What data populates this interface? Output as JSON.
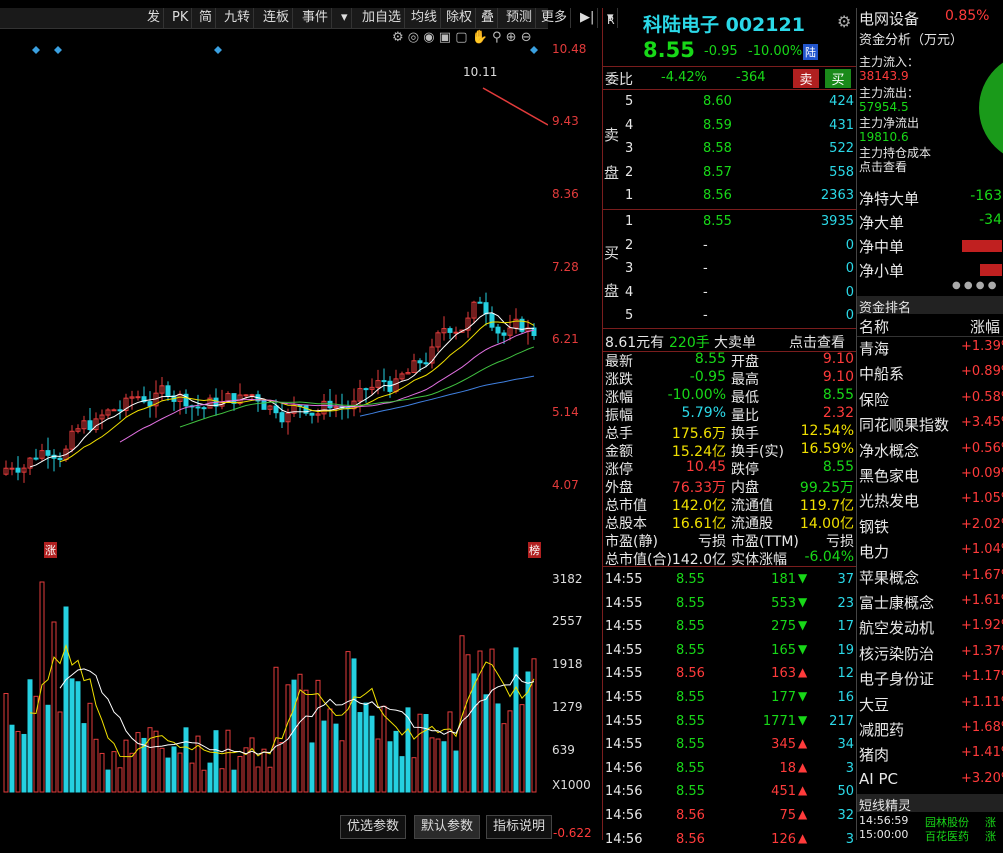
{
  "toolbar": {
    "items": [
      "发",
      "PK",
      "简",
      "九转",
      "连板",
      "事件",
      "▾",
      "加自选",
      "均线",
      "除权",
      "叠",
      "预测",
      "更多",
      "▶|",
      "▾"
    ]
  },
  "main_chart": {
    "price_labels": [
      "10.48",
      "9.43",
      "8.36",
      "7.28",
      "6.21",
      "5.14",
      "4.07"
    ],
    "high_marker": "10.11",
    "left_tag": "涨",
    "right_tag": "榜"
  },
  "vol_chart": {
    "labels": [
      "3182",
      "2557",
      "1918",
      "1279",
      "639",
      "X1000"
    ],
    "bottom_value": "-0.622",
    "tabs": [
      "优选参数",
      "默认参数",
      "指标说明"
    ]
  },
  "quote": {
    "badge": "R",
    "name": "科陆电子 002121",
    "price": "8.55",
    "change": "-0.95",
    "change_pct": "-10.00%",
    "land_tag": "陆",
    "weibi_label": "委比",
    "weibi_pct": "-4.42%",
    "weibi_val": "-364",
    "sell_btn": "卖",
    "buy_btn": "买",
    "sell_side_label": "卖盘",
    "buy_side_label": "买盘",
    "asks": [
      {
        "lvl": "5",
        "price": "8.60",
        "vol": "424"
      },
      {
        "lvl": "4",
        "price": "8.59",
        "vol": "431"
      },
      {
        "lvl": "3",
        "price": "8.58",
        "vol": "522"
      },
      {
        "lvl": "2",
        "price": "8.57",
        "vol": "558"
      },
      {
        "lvl": "1",
        "price": "8.56",
        "vol": "2363"
      }
    ],
    "bids": [
      {
        "lvl": "1",
        "price": "8.55",
        "vol": "3935"
      },
      {
        "lvl": "2",
        "price": "-",
        "vol": "0"
      },
      {
        "lvl": "3",
        "price": "-",
        "vol": "0"
      },
      {
        "lvl": "4",
        "price": "-",
        "vol": "0"
      },
      {
        "lvl": "5",
        "price": "-",
        "vol": "0"
      }
    ],
    "bigorder": {
      "amount": "8.61元有",
      "hands": "220手",
      "label": "大卖单",
      "link": "点击查看"
    },
    "stats": [
      [
        "最新",
        "8.55",
        "开盘",
        "9.10"
      ],
      [
        "涨跌",
        "-0.95",
        "最高",
        "9.10"
      ],
      [
        "涨幅",
        "-10.00%",
        "最低",
        "8.55"
      ],
      [
        "振幅",
        "5.79%",
        "量比",
        "2.32"
      ],
      [
        "总手",
        "175.6万",
        "换手",
        "12.54%"
      ],
      [
        "金额",
        "15.24亿",
        "换手(实)",
        "16.59%"
      ],
      [
        "涨停",
        "10.45",
        "跌停",
        "8.55"
      ],
      [
        "外盘",
        "76.33万",
        "内盘",
        "99.25万"
      ],
      [
        "总市值",
        "142.0亿",
        "流通值",
        "119.7亿"
      ],
      [
        "总股本",
        "16.61亿",
        "流通股",
        "14.00亿"
      ],
      [
        "市盈(静)",
        "亏损",
        "市盈(TTM)",
        "亏损"
      ],
      [
        "总市值(合)",
        "142.0亿",
        "实体涨幅",
        "-6.04%"
      ]
    ],
    "ticks": [
      {
        "time": "14:55",
        "price": "8.55",
        "vol": "181",
        "dir": "down",
        "n": "37"
      },
      {
        "time": "14:55",
        "price": "8.55",
        "vol": "553",
        "dir": "down",
        "n": "23"
      },
      {
        "time": "14:55",
        "price": "8.55",
        "vol": "275",
        "dir": "down",
        "n": "17"
      },
      {
        "time": "14:55",
        "price": "8.55",
        "vol": "165",
        "dir": "down",
        "n": "19"
      },
      {
        "time": "14:55",
        "price": "8.56",
        "vol": "163",
        "dir": "up",
        "n": "12"
      },
      {
        "time": "14:55",
        "price": "8.55",
        "vol": "177",
        "dir": "down",
        "n": "16"
      },
      {
        "time": "14:55",
        "price": "8.55",
        "vol": "1771",
        "dir": "down",
        "n": "217"
      },
      {
        "time": "14:55",
        "price": "8.55",
        "vol": "345",
        "dir": "up",
        "n": "34"
      },
      {
        "time": "14:56",
        "price": "8.55",
        "vol": "18",
        "dir": "up",
        "n": "3"
      },
      {
        "time": "14:56",
        "price": "8.55",
        "vol": "451",
        "dir": "up",
        "n": "50"
      },
      {
        "time": "14:56",
        "price": "8.56",
        "vol": "75",
        "dir": "up",
        "n": "32"
      },
      {
        "time": "14:56",
        "price": "8.56",
        "vol": "126",
        "dir": "up",
        "n": "3"
      }
    ]
  },
  "right": {
    "sector": "电网设备",
    "sector_pct": "0.85%",
    "fund_title": "资金分析（万元）",
    "inflow_label": "主力流入：",
    "inflow": "38143.9",
    "outflow_label": "主力流出：",
    "outflow": "57954.5",
    "net_label": "主力净流出",
    "net": "19810.6",
    "hold_label": "主力持仓成本",
    "hold_link": "点击查看",
    "flows": [
      {
        "label": "净特大单",
        "val": "-163"
      },
      {
        "label": "净大单",
        "val": "-34"
      },
      {
        "label": "净中单",
        "val": ""
      },
      {
        "label": "净小单",
        "val": ""
      }
    ],
    "rank_title": "资金排名",
    "rank_col1": "名称",
    "rank_col2": "涨幅",
    "ranks": [
      {
        "name": "青海",
        "pct": "+1.39%"
      },
      {
        "name": "中船系",
        "pct": "+0.89%"
      },
      {
        "name": "保险",
        "pct": "+0.58%"
      },
      {
        "name": "同花顺果指数",
        "pct": "+3.45%"
      },
      {
        "name": "净水概念",
        "pct": "+0.56%"
      },
      {
        "name": "黑色家电",
        "pct": "+0.09%"
      },
      {
        "name": "光热发电",
        "pct": "+1.05%"
      },
      {
        "name": "钢铁",
        "pct": "+2.02%"
      },
      {
        "name": "电力",
        "pct": "+1.04%"
      },
      {
        "name": "苹果概念",
        "pct": "+1.67%"
      },
      {
        "name": "富士康概念",
        "pct": "+1.61%"
      },
      {
        "name": "航空发动机",
        "pct": "+1.92%"
      },
      {
        "name": "核污染防治",
        "pct": "+1.37%"
      },
      {
        "name": "电子身份证",
        "pct": "+1.17%"
      },
      {
        "name": "大豆",
        "pct": "+1.11%"
      },
      {
        "name": "减肥药",
        "pct": "+1.68%"
      },
      {
        "name": "猪肉",
        "pct": "+1.41%"
      },
      {
        "name": "AI PC",
        "pct": "+3.20%"
      }
    ],
    "short_title": "短线精灵",
    "short_items": [
      {
        "time": "14:56:59",
        "name": "园林股份",
        "tag": "涨"
      },
      {
        "time": "15:00:00",
        "name": "百花医药",
        "tag": "涨"
      }
    ]
  },
  "colors": {
    "up": "#e23b3b",
    "down": "#25d0e0",
    "green": "#18d818"
  }
}
